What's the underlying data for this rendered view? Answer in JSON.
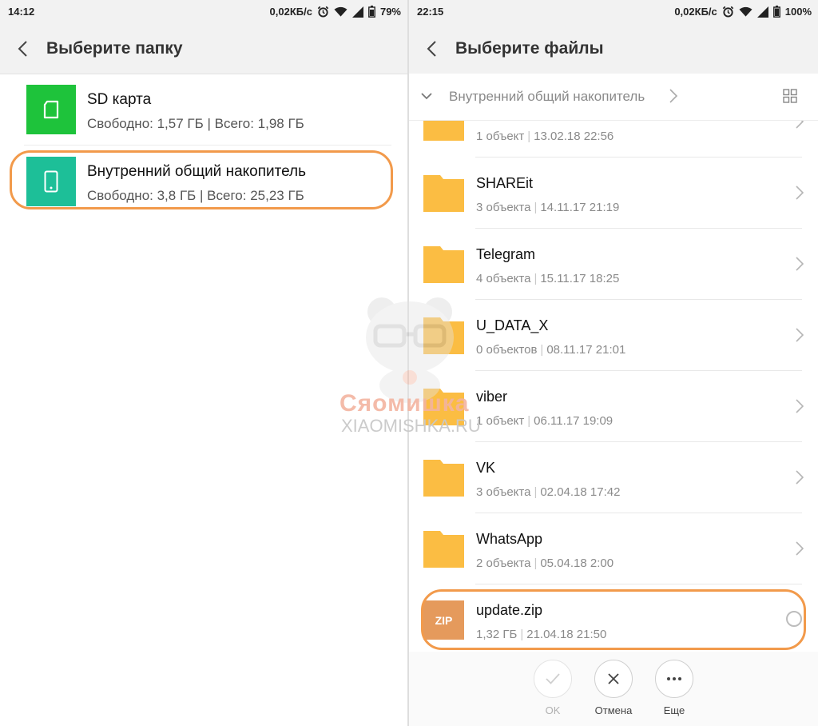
{
  "left": {
    "status": {
      "time": "14:12",
      "speed": "0,02КБ/с",
      "battery": "79%"
    },
    "title": "Выберите папку",
    "storages": [
      {
        "name": "SD карта",
        "sub": "Свободно: 1,57 ГБ | Всего: 1,98 ГБ",
        "icon": "sd-card-icon",
        "color": "#1ec33b"
      },
      {
        "name": "Внутренний общий накопитель",
        "sub": "Свободно: 3,8 ГБ | Всего: 25,23 ГБ",
        "icon": "phone-icon",
        "color": "#1dbf98"
      }
    ]
  },
  "right": {
    "status": {
      "time": "22:15",
      "speed": "0,02КБ/с",
      "battery": "100%"
    },
    "title": "Выберите файлы",
    "path": "Внутренний общий накопитель",
    "folders": [
      {
        "name": "",
        "count": "1 объект",
        "date": "13.02.18 22:56"
      },
      {
        "name": "SHAREit",
        "count": "3 объекта",
        "date": "14.11.17 21:19"
      },
      {
        "name": "Telegram",
        "count": "4 объекта",
        "date": "15.11.17 18:25"
      },
      {
        "name": "U_DATA_X",
        "count": "0 объектов",
        "date": "08.11.17 21:01"
      },
      {
        "name": "viber",
        "count": "1 объект",
        "date": "06.11.17 19:09"
      },
      {
        "name": "VK",
        "count": "3 объекта",
        "date": "02.04.18 17:42"
      },
      {
        "name": "WhatsApp",
        "count": "2 объекта",
        "date": "05.04.18 2:00"
      }
    ],
    "file": {
      "name": "update.zip",
      "size": "1,32 ГБ",
      "date": "21.04.18 21:50",
      "badge": "ZIP"
    },
    "actions": {
      "ok": "OK",
      "cancel": "Отмена",
      "more": "Еще"
    }
  },
  "watermark": {
    "brand": "Сяомишка",
    "site": "XIAOMISHKA.RU"
  },
  "colors": {
    "accent_highlight": "#f29a4b",
    "folder": "#fbbd43",
    "zip": "#e59a5c"
  }
}
